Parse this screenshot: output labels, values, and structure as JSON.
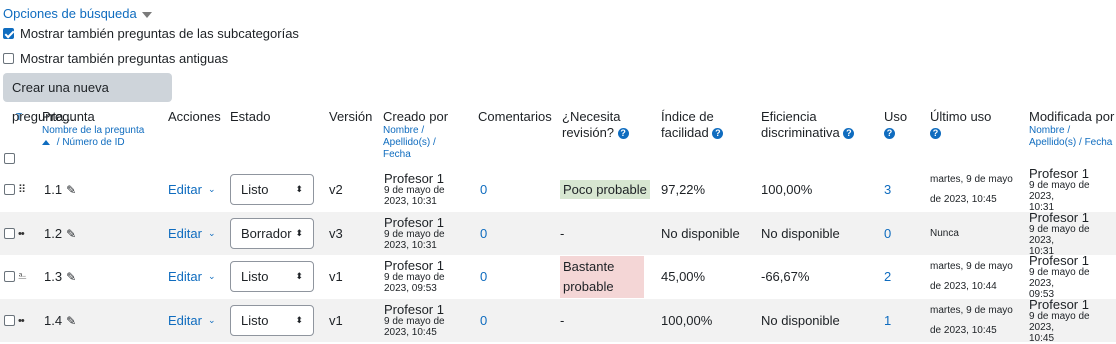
{
  "search_options": {
    "label": "Opciones de búsqueda"
  },
  "checkboxes": {
    "subcategories": {
      "label": "Mostrar también preguntas de las subcategorías",
      "checked": true
    },
    "old": {
      "label": "Mostrar también preguntas antiguas",
      "checked": false
    }
  },
  "create_button": "Crear una nueva pregunta...",
  "header": {
    "t_label": "T",
    "pregunta": "Pregunta",
    "pregunta_sort1": "Nombre de la pregunta",
    "pregunta_sort2": "/ Número de ID",
    "acciones": "Acciones",
    "estado": "Estado",
    "version": "Versión",
    "creado": "Creado por",
    "creado_sort1": "Nombre /",
    "creado_sort2": "Apellido(s) /",
    "creado_sort3": "Fecha",
    "comentarios": "Comentarios",
    "revision1": "¿Necesita",
    "revision2": "revisión?",
    "indice1": "Índice de",
    "indice2": "facilidad",
    "eficiencia1": "Eficiencia",
    "eficiencia2": "discriminativa",
    "uso": "Uso",
    "ultimo": "Último uso",
    "modificada": "Modificada por",
    "mod_sort1": "Nombre /",
    "mod_sort2": "Apellido(s) / Fecha",
    "help_glyph": "?"
  },
  "rows": [
    {
      "icon": "⠿",
      "icon_name": "multichoice-icon",
      "name": "1.1",
      "action": "Editar",
      "status": "Listo",
      "version": "v2",
      "creator": "Profesor 1",
      "created1": "9 de mayo de",
      "created2": "2023, 10:31",
      "comments": "0",
      "review": "Poco probable",
      "review_type": "green",
      "facility": "97,22%",
      "discrimination": "100,00%",
      "usage": "3",
      "last1": "martes, 9 de mayo",
      "last2": "de 2023, 10:45",
      "modifier": "Profesor 1",
      "mod1": "9 de mayo de 2023,",
      "mod2": "10:31"
    },
    {
      "icon": "••",
      "icon_name": "truefalse-icon",
      "name": "1.2",
      "action": "Editar",
      "status": "Borrador",
      "version": "v3",
      "creator": "Profesor 1",
      "created1": "9 de mayo de",
      "created2": "2023, 10:31",
      "comments": "0",
      "review": "-",
      "review_type": "none",
      "facility": "No disponible",
      "discrimination": "No disponible",
      "usage": "0",
      "last1": "Nunca",
      "last2": "",
      "modifier": "Profesor 1",
      "mod1": "9 de mayo de 2023,",
      "mod2": "10:31"
    },
    {
      "icon": "⎁",
      "icon_name": "essay-icon",
      "name": "1.3",
      "action": "Editar",
      "status": "Listo",
      "version": "v1",
      "creator": "Profesor 1",
      "created1": "9 de mayo de",
      "created2": "2023, 09:53",
      "comments": "0",
      "review1": "Bastante",
      "review2": "probable",
      "review_type": "red",
      "facility": "45,00%",
      "discrimination": "-66,67%",
      "usage": "2",
      "last1": "martes, 9 de mayo",
      "last2": "de 2023, 10:44",
      "modifier": "Profesor 1",
      "mod1": "9 de mayo de 2023,",
      "mod2": "09:53"
    },
    {
      "icon": "••",
      "icon_name": "truefalse-icon",
      "name": "1.4",
      "action": "Editar",
      "status": "Listo",
      "version": "v1",
      "creator": "Profesor 1",
      "created1": "9 de mayo de",
      "created2": "2023, 10:45",
      "comments": "0",
      "review": "-",
      "review_type": "none",
      "facility": "100,00%",
      "discrimination": "No disponible",
      "usage": "1",
      "last1": "martes, 9 de mayo",
      "last2": "de 2023, 10:45",
      "modifier": "Profesor 1",
      "mod1": "9 de mayo de 2023,",
      "mod2": "10:45"
    }
  ]
}
